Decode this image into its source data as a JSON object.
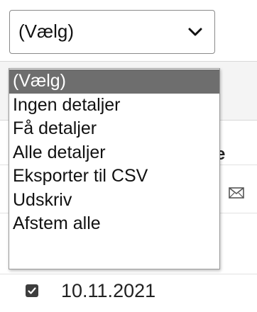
{
  "select": {
    "value": "(Vælg)",
    "icon": "chevron-down-icon"
  },
  "dropdown": {
    "options": [
      {
        "label": "(Vælg)",
        "selected": true
      },
      {
        "label": "Ingen detaljer",
        "selected": false
      },
      {
        "label": "Få detaljer",
        "selected": false
      },
      {
        "label": "Alle detaljer",
        "selected": false
      },
      {
        "label": "Eksporter til CSV",
        "selected": false
      },
      {
        "label": "Udskriv",
        "selected": false
      },
      {
        "label": "Afstem alle",
        "selected": false
      }
    ],
    "selected_background": "#6e6e6e"
  },
  "background": {
    "column_header_fragment": "e",
    "row": {
      "checked": true,
      "date": "10.11.2021"
    },
    "icons": [
      "mail-icon",
      "checkbox-checked-icon"
    ]
  }
}
